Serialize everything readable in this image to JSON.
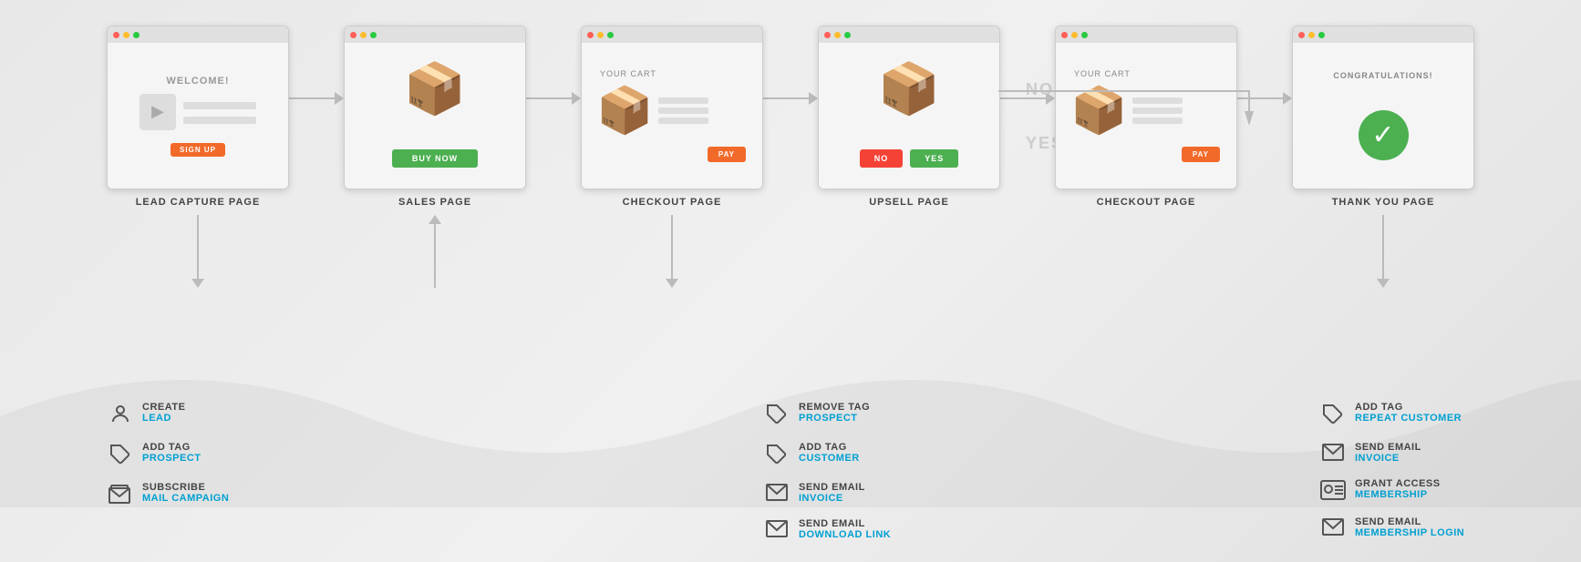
{
  "pages": [
    {
      "id": "lead-capture",
      "type": "lead-capture",
      "label": "LEAD CAPTURE PAGE",
      "content": {
        "title": "WELCOME!",
        "signup_button": "SIGN UP"
      }
    },
    {
      "id": "sales",
      "type": "sales",
      "label": "SALES PAGE",
      "content": {
        "buy_button": "BUY NOW"
      }
    },
    {
      "id": "checkout1",
      "type": "checkout",
      "label": "CHECKOUT PAGE",
      "content": {
        "cart_label": "YOUR CART",
        "pay_button": "PAY"
      }
    },
    {
      "id": "upsell",
      "type": "upsell",
      "label": "UPSELL PAGE",
      "content": {
        "no_button": "NO",
        "yes_button": "YES"
      }
    },
    {
      "id": "checkout2",
      "type": "checkout",
      "label": "CHECKOUT PAGE",
      "content": {
        "cart_label": "YOUR CART",
        "pay_button": "PAY"
      }
    },
    {
      "id": "thankyou",
      "type": "thankyou",
      "label": "THANK YOU PAGE",
      "content": {
        "congrats": "CONGRATULATIONS!"
      }
    }
  ],
  "branch_labels": {
    "no": "NO",
    "yes": "YES"
  },
  "action_groups": [
    {
      "column_id": "lead-actions",
      "items": [
        {
          "icon": "person",
          "title": "CREATE",
          "subtitle": "LEAD"
        },
        {
          "icon": "tag",
          "title": "ADD TAG",
          "subtitle": "PROSPECT"
        },
        {
          "icon": "mail-stack",
          "title": "SUBSCRIBE",
          "subtitle": "MAIL CAMPAIGN"
        }
      ]
    },
    {
      "column_id": "checkout-actions",
      "items": [
        {
          "icon": "tag",
          "title": "REMOVE TAG",
          "subtitle": "PROSPECT"
        },
        {
          "icon": "tag",
          "title": "ADD TAG",
          "subtitle": "CUSTOMER"
        },
        {
          "icon": "envelope",
          "title": "SEND EMAIL",
          "subtitle": "INVOICE"
        },
        {
          "icon": "envelope",
          "title": "SEND EMAIL",
          "subtitle": "DOWNLOAD LINK"
        }
      ]
    },
    {
      "column_id": "thankyou-actions",
      "items": [
        {
          "icon": "tag",
          "title": "ADD TAG",
          "subtitle": "REPEAT CUSTOMER"
        },
        {
          "icon": "envelope",
          "title": "SEND EMAIL",
          "subtitle": "INVOICE"
        },
        {
          "icon": "id-card",
          "title": "GRANT ACCESS",
          "subtitle": "MEMBERSHIP"
        },
        {
          "icon": "envelope",
          "title": "SEND EMAIL",
          "subtitle": "MEMBERSHIP LOGIN"
        }
      ]
    }
  ]
}
